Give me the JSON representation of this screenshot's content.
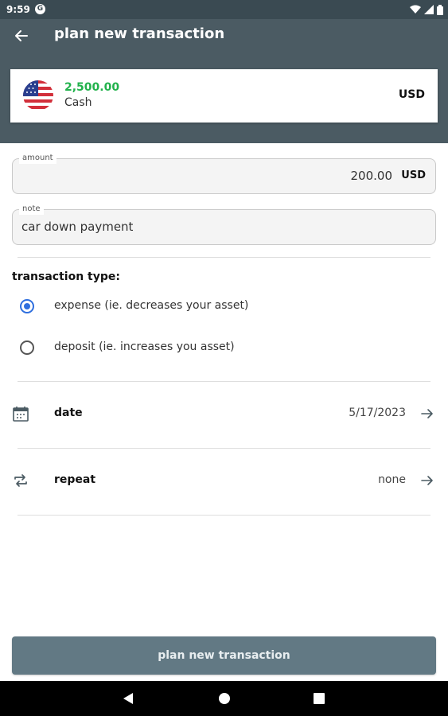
{
  "status_bar": {
    "time": "9:59",
    "notification_icon": "G"
  },
  "app_bar": {
    "title": "plan new transaction",
    "back_icon": "arrow-left-icon"
  },
  "account": {
    "balance": "2,500.00",
    "name": "Cash",
    "currency": "USD",
    "flag_icon": "us-flag-icon"
  },
  "amount_field": {
    "label": "amount",
    "value": "200.00",
    "currency": "USD"
  },
  "note_field": {
    "label": "note",
    "value": "car down payment"
  },
  "transaction_type": {
    "title": "transaction type:",
    "options": [
      {
        "label": "expense (ie. decreases your asset)",
        "selected": true
      },
      {
        "label": "deposit (ie. increases you asset)",
        "selected": false
      }
    ]
  },
  "date_row": {
    "label": "date",
    "value": "5/17/2023",
    "icon": "calendar-icon"
  },
  "repeat_row": {
    "label": "repeat",
    "value": "none",
    "icon": "repeat-icon"
  },
  "submit": {
    "label": "plan new transaction"
  },
  "colors": {
    "appbar": "#4b5b63",
    "balance_green": "#22b24c",
    "radio_blue": "#2f6fde",
    "button": "#627984"
  }
}
